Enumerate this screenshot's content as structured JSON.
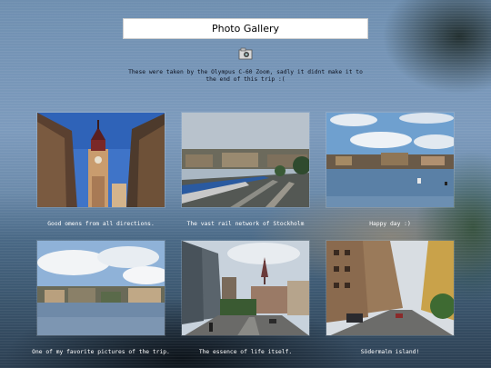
{
  "header": {
    "title": "Photo Gallery"
  },
  "intro": {
    "icon": "camera-icon",
    "text": "These were taken by the Olympus C-60 Zoom, sadly it didnt make it to the end of this trip :("
  },
  "photos": [
    {
      "caption": "Good omens from all directions."
    },
    {
      "caption": "The vast rail network of Stockholm"
    },
    {
      "caption": "Happy day :)"
    },
    {
      "caption": "One of my favorite pictures of the trip."
    },
    {
      "caption": "The essence of life itself."
    },
    {
      "caption": "Södermalm island!"
    }
  ]
}
